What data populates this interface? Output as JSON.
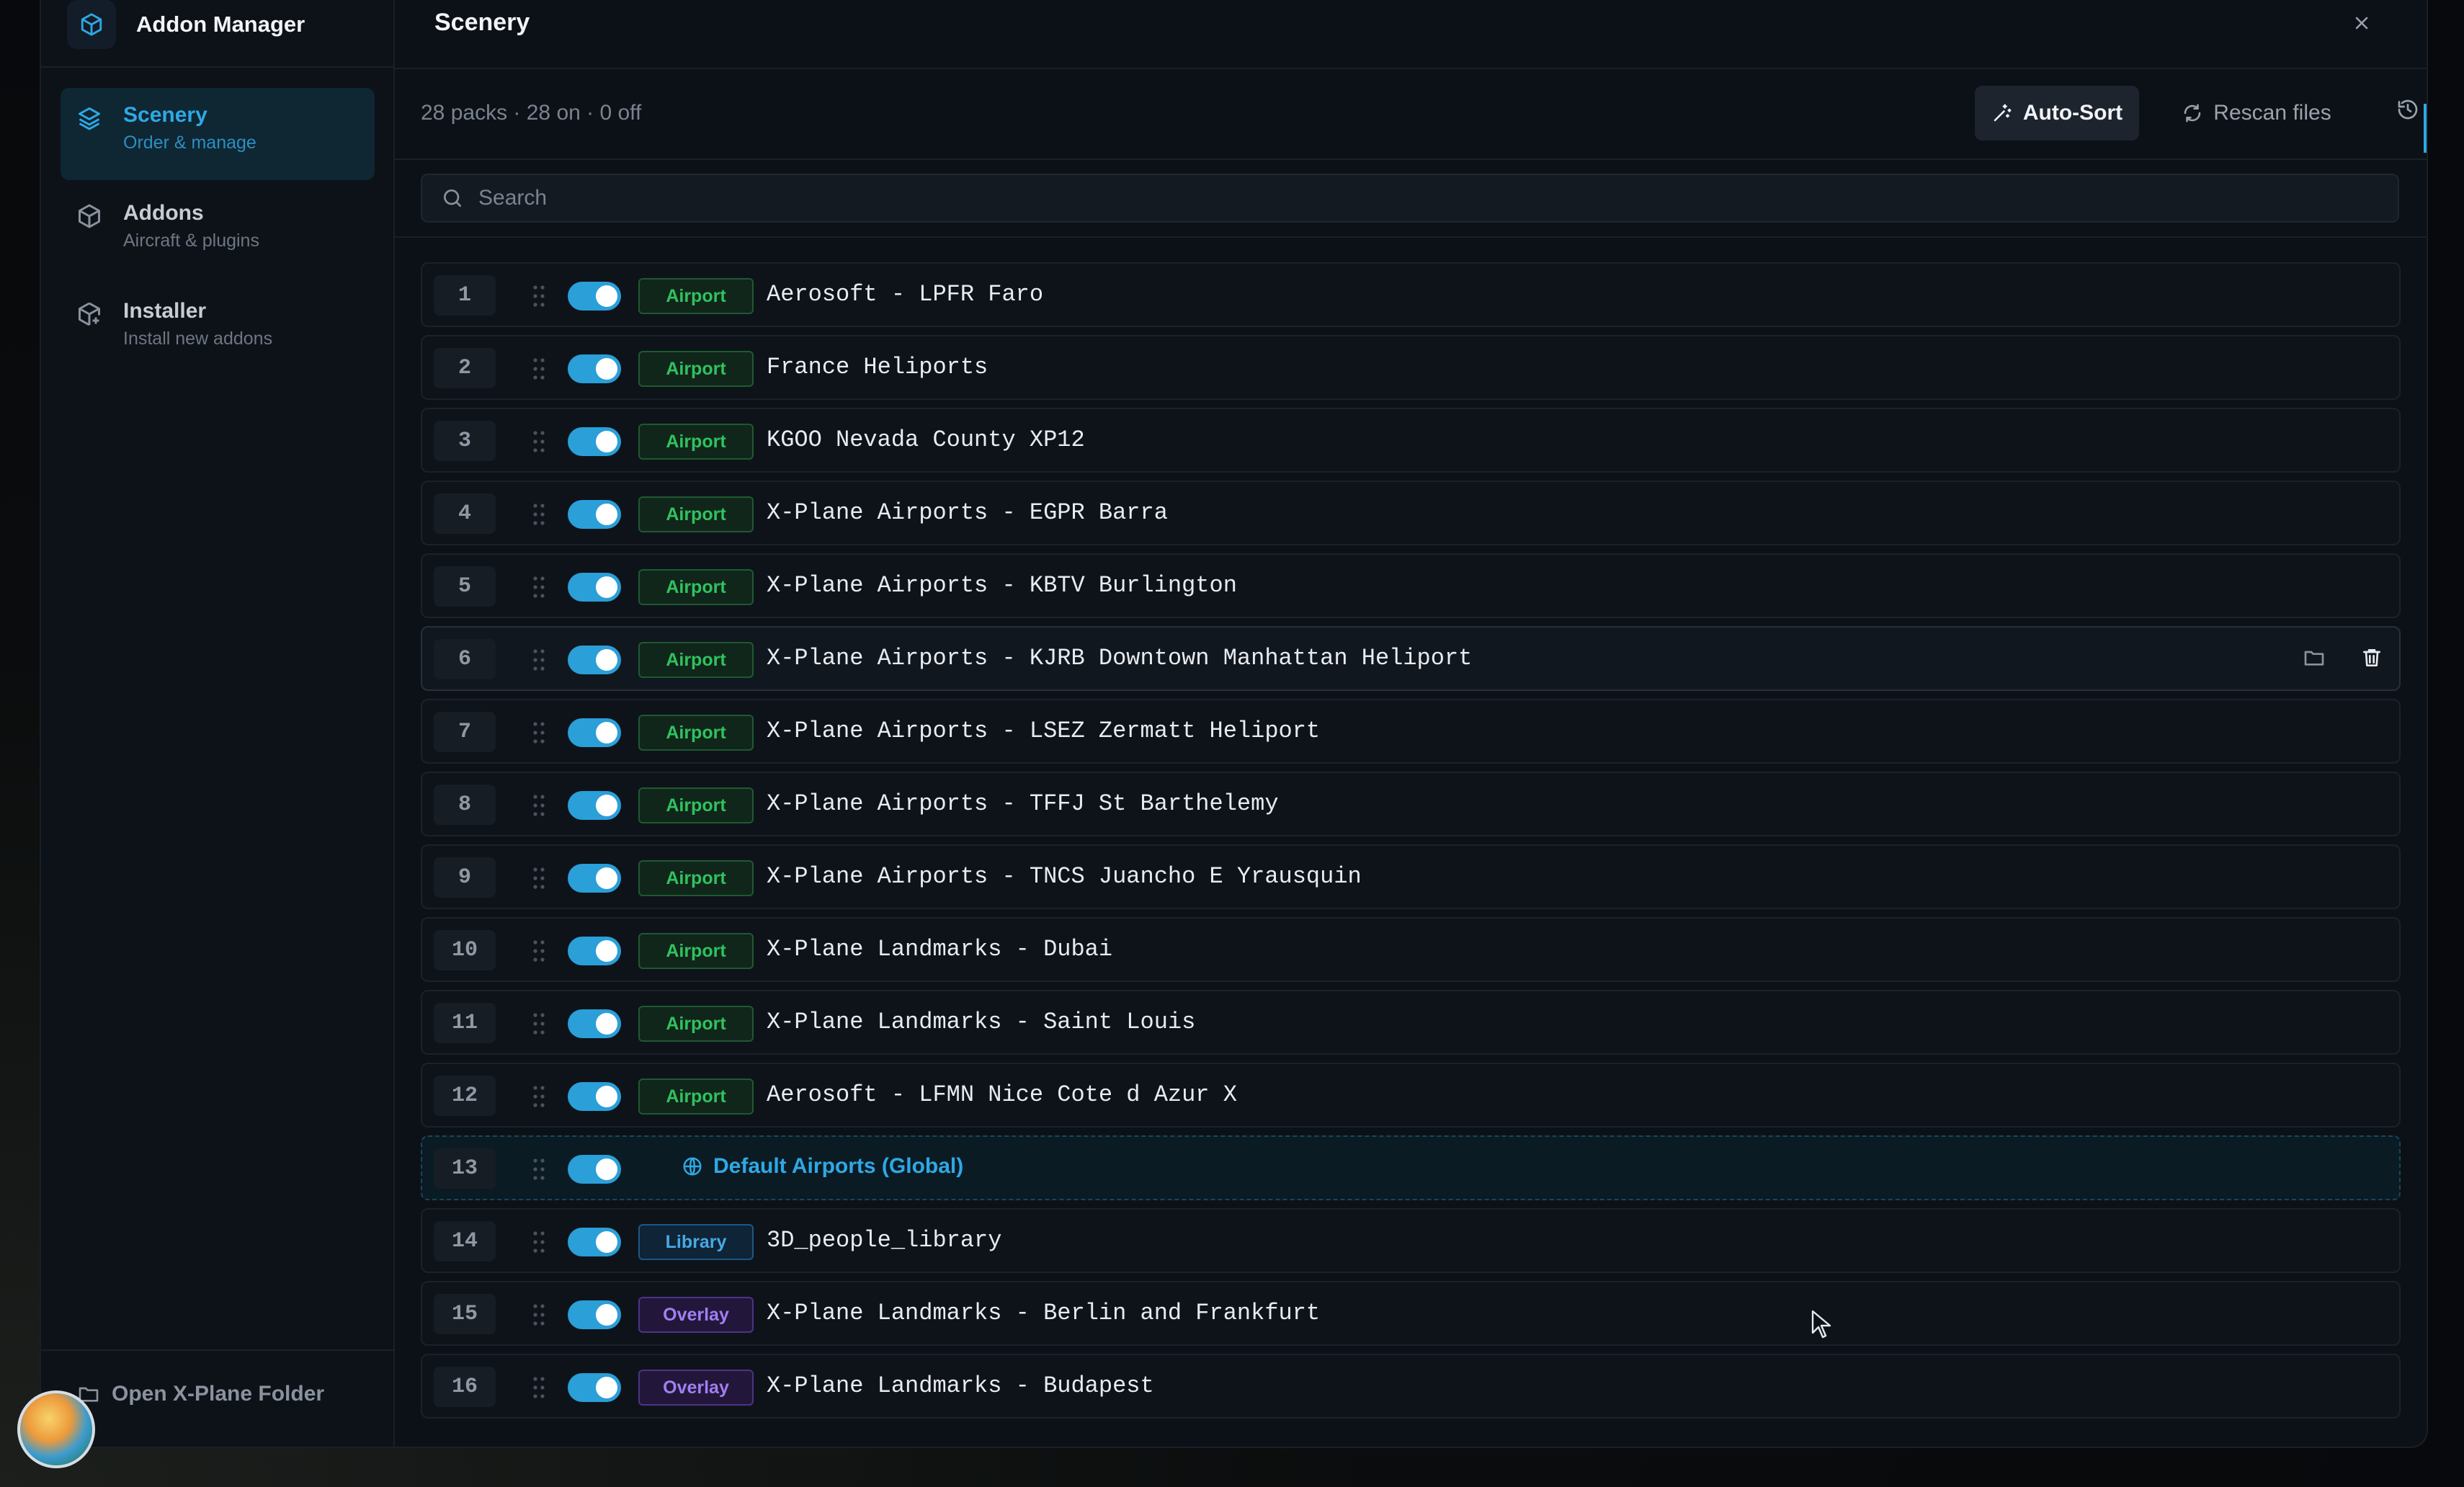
{
  "app": {
    "title": "Addon Manager"
  },
  "sidebar": {
    "items": [
      {
        "label": "Scenery",
        "sub": "Order & manage",
        "active": true,
        "icon": "layers-icon"
      },
      {
        "label": "Addons",
        "sub": "Aircraft & plugins",
        "active": false,
        "icon": "package-icon"
      },
      {
        "label": "Installer",
        "sub": "Install new addons",
        "active": false,
        "icon": "package-plus-icon"
      }
    ],
    "footer_label": "Open X-Plane Folder"
  },
  "header": {
    "title": "Scenery"
  },
  "toolbar": {
    "summary": "28 packs · 28 on · 0 off",
    "autosort_label": "Auto-Sort",
    "rescan_label": "Rescan files"
  },
  "search": {
    "placeholder": "Search",
    "value": ""
  },
  "packs": [
    {
      "index": "1",
      "type": "Airport",
      "name": "Aerosoft - LPFR Faro",
      "enabled": true
    },
    {
      "index": "2",
      "type": "Airport",
      "name": "France Heliports",
      "enabled": true
    },
    {
      "index": "3",
      "type": "Airport",
      "name": "KGOO Nevada County XP12",
      "enabled": true
    },
    {
      "index": "4",
      "type": "Airport",
      "name": "X-Plane Airports - EGPR Barra",
      "enabled": true
    },
    {
      "index": "5",
      "type": "Airport",
      "name": "X-Plane Airports - KBTV Burlington",
      "enabled": true
    },
    {
      "index": "6",
      "type": "Airport",
      "name": "X-Plane Airports - KJRB Downtown Manhattan Heliport",
      "enabled": true
    },
    {
      "index": "7",
      "type": "Airport",
      "name": "X-Plane Airports - LSEZ Zermatt Heliport",
      "enabled": true
    },
    {
      "index": "8",
      "type": "Airport",
      "name": "X-Plane Airports - TFFJ St Barthelemy",
      "enabled": true
    },
    {
      "index": "9",
      "type": "Airport",
      "name": "X-Plane Airports - TNCS Juancho E Yrausquin",
      "enabled": true
    },
    {
      "index": "10",
      "type": "Airport",
      "name": "X-Plane Landmarks - Dubai",
      "enabled": true
    },
    {
      "index": "11",
      "type": "Airport",
      "name": "X-Plane Landmarks - Saint Louis",
      "enabled": true
    },
    {
      "index": "12",
      "type": "Airport",
      "name": "Aerosoft - LFMN Nice Cote d Azur X",
      "enabled": true
    },
    {
      "index": "13",
      "type": "Global",
      "name": "Default Airports (Global)",
      "enabled": true
    },
    {
      "index": "14",
      "type": "Library",
      "name": "3D_people_library",
      "enabled": true
    },
    {
      "index": "15",
      "type": "Overlay",
      "name": "X-Plane Landmarks - Berlin and Frankfurt",
      "enabled": true
    },
    {
      "index": "16",
      "type": "Overlay",
      "name": "X-Plane Landmarks - Budapest",
      "enabled": true
    }
  ],
  "colors": {
    "accent": "#2fa8e4",
    "airport": "#2fc260",
    "library": "#47a8e6",
    "overlay": "#a27ef2"
  }
}
